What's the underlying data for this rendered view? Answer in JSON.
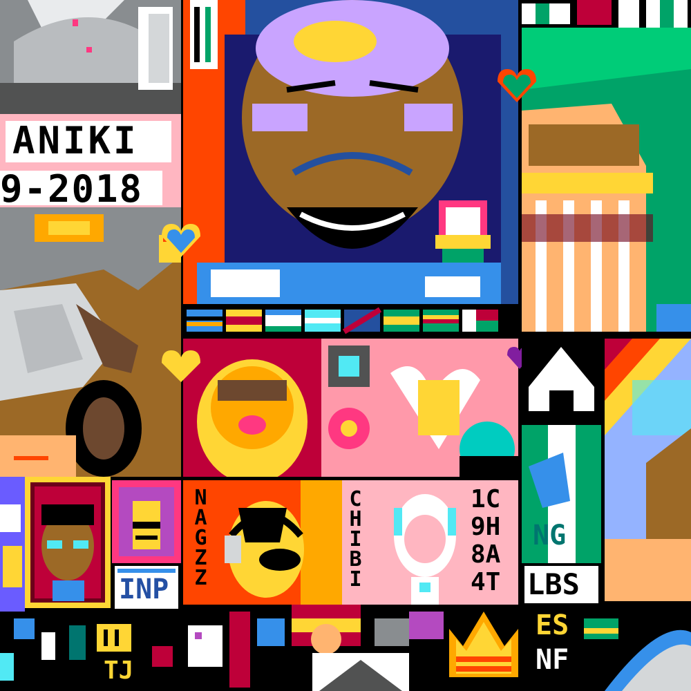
{
  "canvas": {
    "description_free": true
  },
  "labels": {
    "aniki_name": "ANIKI",
    "aniki_years": "9-2018",
    "nagzz": "NAGZZ",
    "chibi": "CHIBI",
    "code_col1": "1C9H8A4T",
    "inp": "INP",
    "lbs": "LBS",
    "ng": "NG",
    "tj": "TJ",
    "es": "ES",
    "nf": "NF"
  },
  "colors": {
    "background": "#000000",
    "orange": "#ff4500",
    "navy": "#24509f",
    "green": "#00a368",
    "pink": "#ffb6c1",
    "yellow": "#ffd635",
    "brown": "#9c6926",
    "gray": "#898d90"
  }
}
